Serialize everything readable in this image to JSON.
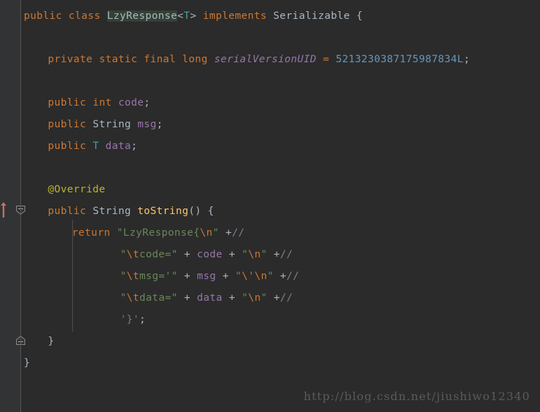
{
  "editor": {
    "theme_name": "darcula",
    "background_color": "#2b2b2b",
    "gutter_color": "#313335",
    "caret_line_color": "#323232",
    "selection_highlight_color": "#344134",
    "language": "java"
  },
  "colors": {
    "keyword": "#cc7832",
    "field": "#9876aa",
    "method": "#ffc66d",
    "string": "#6a8759",
    "number": "#6897bb",
    "annotation": "#bbb529",
    "comment": "#808080",
    "default_text": "#a9b7c6",
    "generic_type": "#4b9c9c",
    "run_marker": "#c97064"
  },
  "code": {
    "lines": [
      {
        "n": 1,
        "indent": 0,
        "tokens": [
          {
            "t": "public",
            "c": "kw"
          },
          {
            "t": " ",
            "c": "punc"
          },
          {
            "t": "class",
            "c": "kw"
          },
          {
            "t": " ",
            "c": "punc"
          },
          {
            "t": "LzyResponse",
            "c": "sel-ident"
          },
          {
            "t": "<",
            "c": "punc"
          },
          {
            "t": "T",
            "c": "gen"
          },
          {
            "t": ">",
            "c": "punc"
          },
          {
            "t": " ",
            "c": "punc"
          },
          {
            "t": "implements",
            "c": "kw"
          },
          {
            "t": " ",
            "c": "punc"
          },
          {
            "t": "Serializable",
            "c": "type"
          },
          {
            "t": " {",
            "c": "punc"
          }
        ]
      },
      {
        "n": 3,
        "indent": 1,
        "tokens": [
          {
            "t": "private",
            "c": "kw"
          },
          {
            "t": " ",
            "c": "punc"
          },
          {
            "t": "static",
            "c": "kw"
          },
          {
            "t": " ",
            "c": "punc"
          },
          {
            "t": "final",
            "c": "kw"
          },
          {
            "t": " ",
            "c": "punc"
          },
          {
            "t": "long",
            "c": "kw"
          },
          {
            "t": " ",
            "c": "punc"
          },
          {
            "t": "serialVersionUID",
            "c": "fielditl"
          },
          {
            "t": " ",
            "c": "punc"
          },
          {
            "t": "=",
            "c": "kw"
          },
          {
            "t": " ",
            "c": "punc"
          },
          {
            "t": "5213230387175987834L",
            "c": "num"
          },
          {
            "t": ";",
            "c": "punc"
          }
        ]
      },
      {
        "n": 5,
        "indent": 1,
        "tokens": [
          {
            "t": "public",
            "c": "kw"
          },
          {
            "t": " ",
            "c": "punc"
          },
          {
            "t": "int",
            "c": "kw"
          },
          {
            "t": " ",
            "c": "punc"
          },
          {
            "t": "code",
            "c": "field"
          },
          {
            "t": ";",
            "c": "punc"
          }
        ]
      },
      {
        "n": 6,
        "indent": 1,
        "tokens": [
          {
            "t": "public",
            "c": "kw"
          },
          {
            "t": " ",
            "c": "punc"
          },
          {
            "t": "String",
            "c": "type"
          },
          {
            "t": " ",
            "c": "punc"
          },
          {
            "t": "msg",
            "c": "field"
          },
          {
            "t": ";",
            "c": "punc"
          }
        ]
      },
      {
        "n": 7,
        "indent": 1,
        "tokens": [
          {
            "t": "public",
            "c": "kw"
          },
          {
            "t": " ",
            "c": "punc"
          },
          {
            "t": "T",
            "c": "gen"
          },
          {
            "t": " ",
            "c": "punc"
          },
          {
            "t": "data",
            "c": "field"
          },
          {
            "t": ";",
            "c": "punc"
          }
        ]
      },
      {
        "n": 9,
        "indent": 1,
        "tokens": [
          {
            "t": "@Override",
            "c": "anno"
          }
        ]
      },
      {
        "n": 10,
        "indent": 1,
        "tokens": [
          {
            "t": "public",
            "c": "kw"
          },
          {
            "t": " ",
            "c": "punc"
          },
          {
            "t": "String",
            "c": "type"
          },
          {
            "t": " ",
            "c": "punc"
          },
          {
            "t": "toString",
            "c": "method"
          },
          {
            "t": "() {",
            "c": "punc"
          }
        ]
      },
      {
        "n": 11,
        "indent": 2,
        "tokens": [
          {
            "t": "return",
            "c": "kw"
          },
          {
            "t": " ",
            "c": "punc"
          },
          {
            "t": "\"LzyResponse{",
            "c": "str"
          },
          {
            "t": "\\n",
            "c": "esc"
          },
          {
            "t": "\"",
            "c": "str"
          },
          {
            "t": " ",
            "c": "punc"
          },
          {
            "t": "+",
            "c": "punc"
          },
          {
            "t": "//",
            "c": "cmt"
          }
        ]
      },
      {
        "n": 12,
        "indent": 4,
        "tokens": [
          {
            "t": "\"",
            "c": "str"
          },
          {
            "t": "\\t",
            "c": "esc"
          },
          {
            "t": "code=\"",
            "c": "str"
          },
          {
            "t": " + ",
            "c": "punc"
          },
          {
            "t": "code",
            "c": "field"
          },
          {
            "t": " + ",
            "c": "punc"
          },
          {
            "t": "\"",
            "c": "str"
          },
          {
            "t": "\\n",
            "c": "esc"
          },
          {
            "t": "\"",
            "c": "str"
          },
          {
            "t": " ",
            "c": "punc"
          },
          {
            "t": "+",
            "c": "punc"
          },
          {
            "t": "//",
            "c": "cmt"
          }
        ]
      },
      {
        "n": 13,
        "indent": 4,
        "tokens": [
          {
            "t": "\"",
            "c": "str"
          },
          {
            "t": "\\t",
            "c": "esc"
          },
          {
            "t": "msg='\"",
            "c": "str"
          },
          {
            "t": " + ",
            "c": "punc"
          },
          {
            "t": "msg",
            "c": "field"
          },
          {
            "t": " + ",
            "c": "punc"
          },
          {
            "t": "\"",
            "c": "str"
          },
          {
            "t": "\\'",
            "c": "esc"
          },
          {
            "t": "\\n",
            "c": "esc"
          },
          {
            "t": "\"",
            "c": "str"
          },
          {
            "t": " ",
            "c": "punc"
          },
          {
            "t": "+",
            "c": "punc"
          },
          {
            "t": "//",
            "c": "cmt"
          }
        ]
      },
      {
        "n": 14,
        "indent": 4,
        "tokens": [
          {
            "t": "\"",
            "c": "str"
          },
          {
            "t": "\\t",
            "c": "esc"
          },
          {
            "t": "data=\"",
            "c": "str"
          },
          {
            "t": " + ",
            "c": "punc"
          },
          {
            "t": "data",
            "c": "field"
          },
          {
            "t": " + ",
            "c": "punc"
          },
          {
            "t": "\"",
            "c": "str"
          },
          {
            "t": "\\n",
            "c": "esc"
          },
          {
            "t": "\"",
            "c": "str"
          },
          {
            "t": " ",
            "c": "punc"
          },
          {
            "t": "+",
            "c": "punc"
          },
          {
            "t": "//",
            "c": "cmt"
          }
        ]
      },
      {
        "n": 15,
        "indent": 4,
        "tokens": [
          {
            "t": "'}'",
            "c": "str"
          },
          {
            "t": ";",
            "c": "punc"
          }
        ]
      },
      {
        "n": 16,
        "indent": 1,
        "tokens": [
          {
            "t": "}",
            "c": "punc"
          }
        ]
      },
      {
        "n": 17,
        "indent": 0,
        "tokens": [
          {
            "t": "}",
            "c": "punc"
          }
        ]
      }
    ]
  },
  "gutter": {
    "fold_markers": [
      {
        "name": "fold-collapse-method",
        "direction": "down",
        "symbol": "minus"
      },
      {
        "name": "fold-expand-method-end",
        "direction": "up",
        "symbol": "minus"
      }
    ],
    "run_marker": {
      "name": "run-method-arrow",
      "symbol": "arrow-up"
    }
  },
  "watermark": {
    "text": "http://blog.csdn.net/jiushiwo12340"
  }
}
